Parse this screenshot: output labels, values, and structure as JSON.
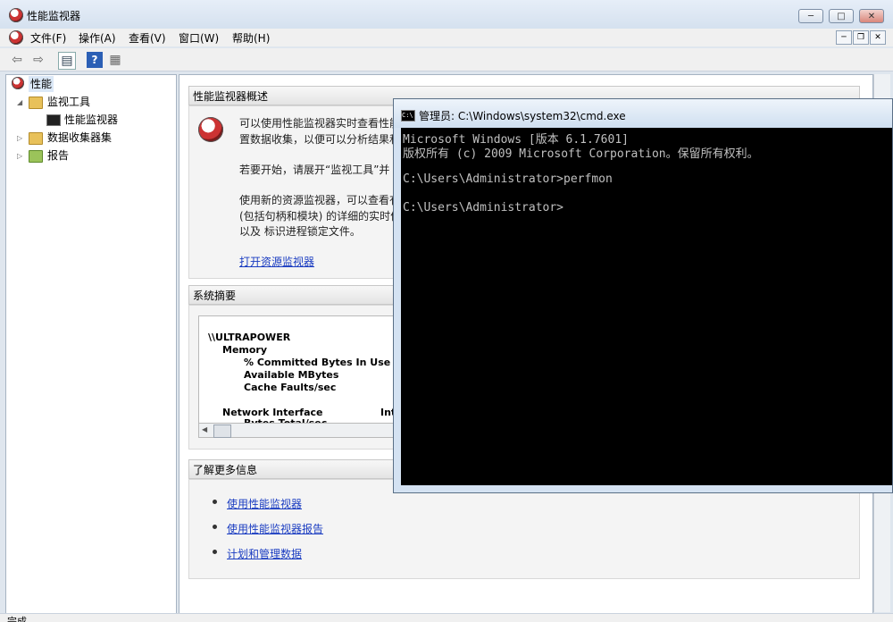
{
  "window": {
    "title": "性能监视器"
  },
  "caption_buttons": {
    "minimize": "─",
    "maximize": "□",
    "close": "✕"
  },
  "menu": [
    "文件(F)",
    "操作(A)",
    "查看(V)",
    "窗口(W)",
    "帮助(H)"
  ],
  "mdi_buttons": {
    "minimize": "─",
    "restore": "❐",
    "close": "✕"
  },
  "toolbar": [
    "back-icon",
    "forward-icon",
    "show-hide-tree-icon",
    "help-icon",
    "properties-icon"
  ],
  "tree": {
    "root": "性能",
    "items": [
      {
        "label": "监视工具"
      },
      {
        "label": "性能监视器"
      },
      {
        "label": "数据收集器集"
      },
      {
        "label": "报告"
      }
    ]
  },
  "overview": {
    "header": "性能监视器概述",
    "line1": "可以使用性能监视器实时查看性能",
    "line2": "置数据收集，以便可以分析结果和",
    "line3": "若要开始，请展开“监视工具”并",
    "line4": "使用新的资源监视器，可以查看有",
    "line5": "(包括句柄和模块) 的详细的实时信",
    "line6": "以及 标识进程锁定文件。",
    "link": "打开资源监视器"
  },
  "summary": {
    "header": "系统摘要",
    "lines": [
      "\\\\ULTRAPOWER",
      "Memory",
      "% Committed Bytes In Use",
      "Available MBytes",
      "Cache Faults/sec",
      "Network Interface",
      "Int",
      "Bytes Total/sec"
    ]
  },
  "more_info": {
    "header": "了解更多信息",
    "links": [
      "使用性能监视器",
      "使用性能监视器报告",
      "计划和管理数据"
    ]
  },
  "status": {
    "text": "完成"
  },
  "cmd": {
    "title": "管理员: C:\\Windows\\system32\\cmd.exe",
    "lines": [
      "Microsoft Windows [版本 6.1.7601]",
      "版权所有 (c) 2009 Microsoft Corporation。保留所有权利。",
      "",
      "C:\\Users\\Administrator>perfmon",
      "",
      "C:\\Users\\Administrator>"
    ]
  },
  "colors": {
    "link": "#1a3cc1",
    "console_bg": "#000000",
    "console_fg": "#c0c0c0"
  }
}
